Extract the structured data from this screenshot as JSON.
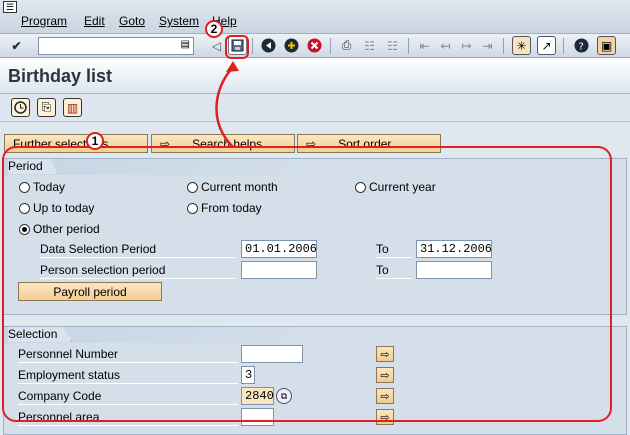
{
  "menubar": {
    "items": [
      "Program",
      "Edit",
      "Goto",
      "System",
      "Help"
    ]
  },
  "toolbar": {
    "command_field": ""
  },
  "title": "Birthday list",
  "app_buttons": {
    "further": "Further selections",
    "search": "Search helps",
    "sort": "Sort order"
  },
  "period": {
    "title": "Period",
    "today": "Today",
    "current_month": "Current month",
    "current_year": "Current year",
    "up_to_today": "Up to today",
    "from_today": "From today",
    "other_period": "Other period",
    "data_selection_label": "Data Selection Period",
    "data_from": "01.01.2006",
    "to_label": "To",
    "data_to": "31.12.2006",
    "person_label": "Person selection period",
    "person_from": "",
    "person_to": "",
    "payroll": "Payroll period"
  },
  "selection": {
    "title": "Selection",
    "personnel_number": "Personnel Number",
    "personnel_number_value": "",
    "employment_status": "Employment status",
    "employment_status_value": "3",
    "company_code": "Company Code",
    "company_code_value": "2840",
    "personnel_area": "Personnel area"
  },
  "callouts": {
    "one": "1",
    "two": "2"
  },
  "colors": {
    "accent": "#e02020",
    "button": "#f3cf92"
  }
}
